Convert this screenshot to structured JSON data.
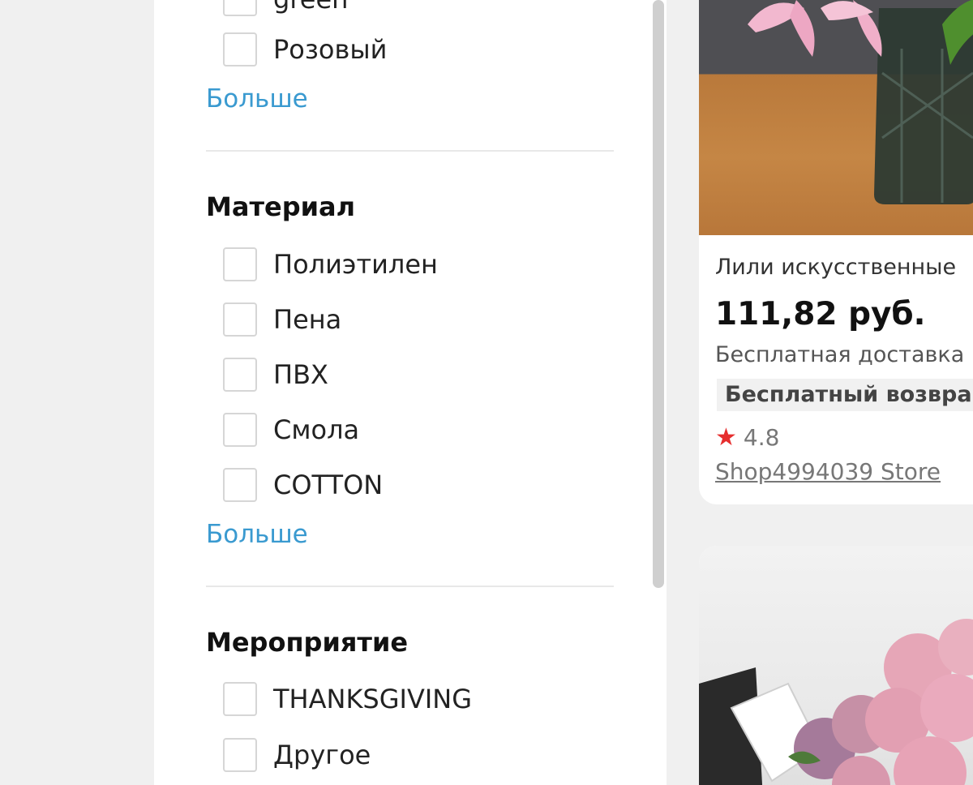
{
  "filters": {
    "color": {
      "options": [
        "green",
        "Розовый"
      ],
      "more_label": "Больше"
    },
    "material": {
      "title": "Материал",
      "options": [
        "Полиэтилен",
        "Пена",
        "ПВХ",
        "Смола",
        "COTTON"
      ],
      "more_label": "Больше"
    },
    "event": {
      "title": "Мероприятие",
      "options": [
        "THANKSGIVING",
        "Другое"
      ]
    }
  },
  "products": [
    {
      "title": "Лили искусственные",
      "price": "111,82 руб.",
      "shipping": "Бесплатная доставка",
      "badge": "Бесплатный возвра",
      "rating": "4.8",
      "store": "Shop4994039 Store",
      "icon": "star-icon"
    },
    {
      "image": "pink-peony-bouquet"
    }
  ],
  "colors": {
    "link": "#3a9ad0",
    "star": "#e62e2e",
    "page_bg": "#f0f0f0"
  }
}
